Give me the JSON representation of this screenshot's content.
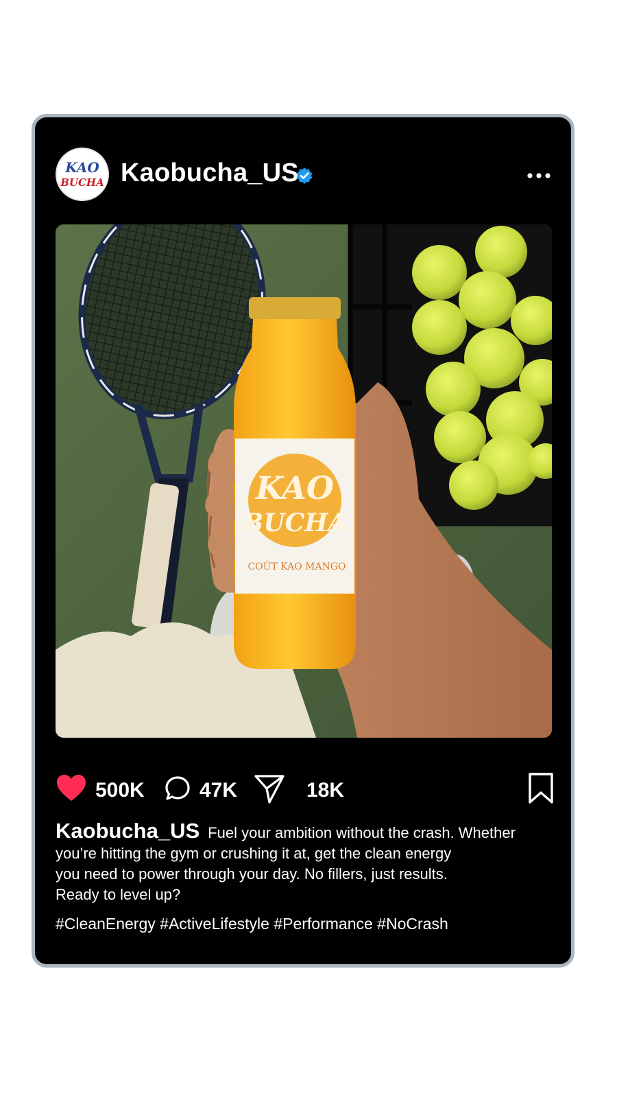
{
  "post": {
    "username": "Kaobucha_US",
    "avatar_text_1": "KAO",
    "avatar_text_2": "BUCHA",
    "label_text_1": "KAO",
    "label_text_2": "BUCHA",
    "label_flavor": "COÛT KAO MANGO",
    "likes": "500K",
    "comments": "47K",
    "shares": "18K",
    "caption_username": "Kaobucha_US",
    "caption_lines": [
      "Fuel your ambition without the crash. Whether",
      "you’re hitting the gym or crushing it at, get the clean energy",
      "you need to power through your day. No fillers, just results.",
      "Ready to level up?"
    ],
    "hashtags": "#CleanEnergy #ActiveLifestyle #Performance #NoCrash"
  },
  "icons": {
    "verified": "verified-badge-icon",
    "more": "more-options-icon",
    "like": "heart-icon",
    "comment": "comment-icon",
    "share": "send-icon",
    "save": "bookmark-icon"
  },
  "colors": {
    "background": "#000000",
    "frame_border": "#a9b6bf",
    "heart": "#ff2d55",
    "verified": "#1d9bf0",
    "text": "#ffffff"
  }
}
